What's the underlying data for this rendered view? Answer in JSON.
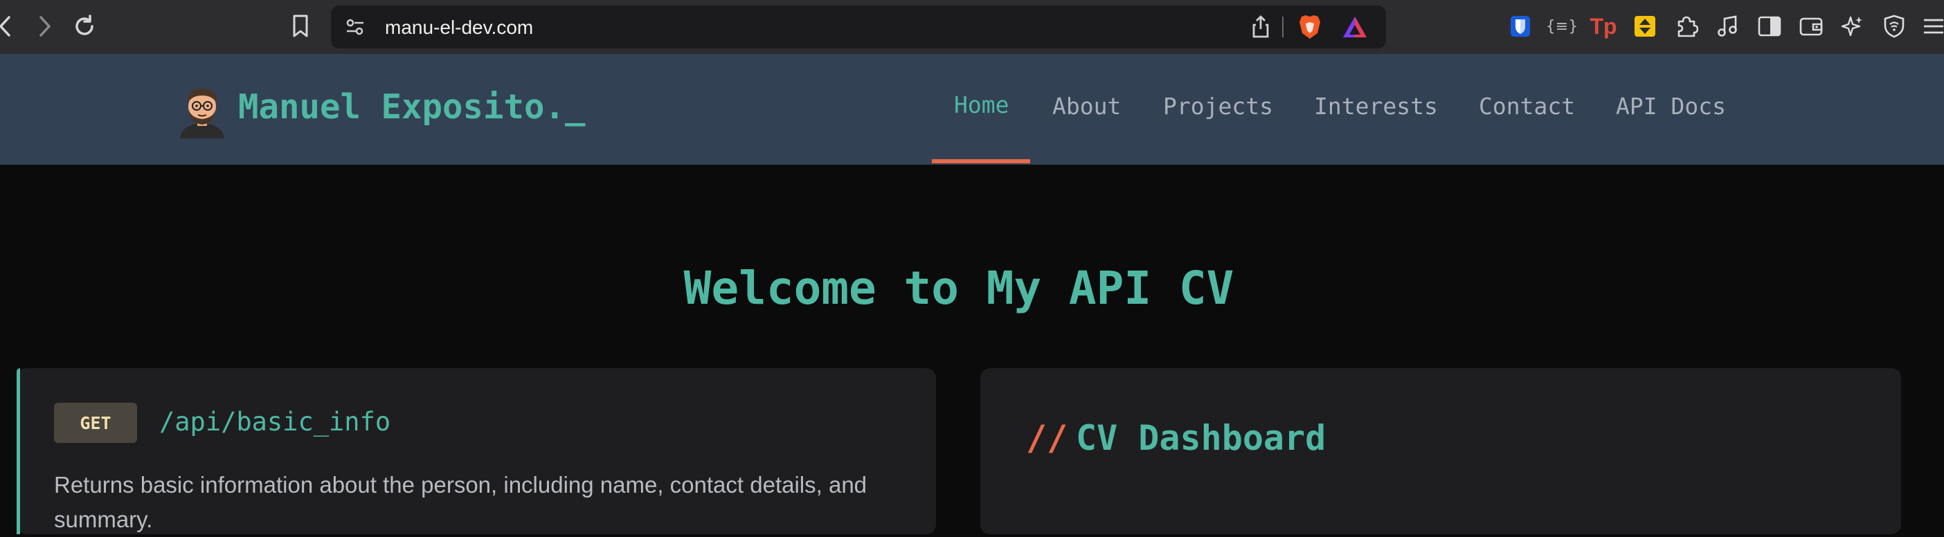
{
  "browser": {
    "url": "manu-el-dev.com",
    "icons": {
      "back": "chevron-left-icon",
      "forward": "chevron-right-icon",
      "reload": "reload-icon",
      "bookmark": "bookmark-icon",
      "site_settings": "site-settings-icon",
      "share": "share-icon",
      "shields": "brave-shields-icon",
      "rewards": "brave-rewards-icon"
    },
    "extensions": [
      "bitwarden-icon",
      "json-viewer-icon",
      "tp-extension-icon",
      "yellow-extension-icon",
      "extensions-puzzle-icon",
      "music-icon",
      "sidebar-icon",
      "wallet-icon",
      "leo-ai-icon",
      "vpn-shield-icon",
      "menu-icon"
    ],
    "tp_label": "Tp",
    "json_label": "{≡}"
  },
  "site": {
    "brand": "Manuel Exposito._",
    "nav": [
      {
        "label": "Home",
        "active": true
      },
      {
        "label": "About",
        "active": false
      },
      {
        "label": "Projects",
        "active": false
      },
      {
        "label": "Interests",
        "active": false
      },
      {
        "label": "Contact",
        "active": false
      },
      {
        "label": "API Docs",
        "active": false
      }
    ]
  },
  "main": {
    "title": "Welcome to My API CV",
    "endpoint_card": {
      "method": "GET",
      "path": "/api/basic_info",
      "description": "Returns basic information about the person, including name, contact details, and summary."
    },
    "dashboard_card": {
      "prefix": "//",
      "title": "CV Dashboard"
    }
  },
  "colors": {
    "accent": "#4fb8a3",
    "active_underline": "#e86a4a",
    "header_bg": "#334155",
    "page_bg": "#0b0b0b",
    "card_bg": "#1e1e20"
  }
}
